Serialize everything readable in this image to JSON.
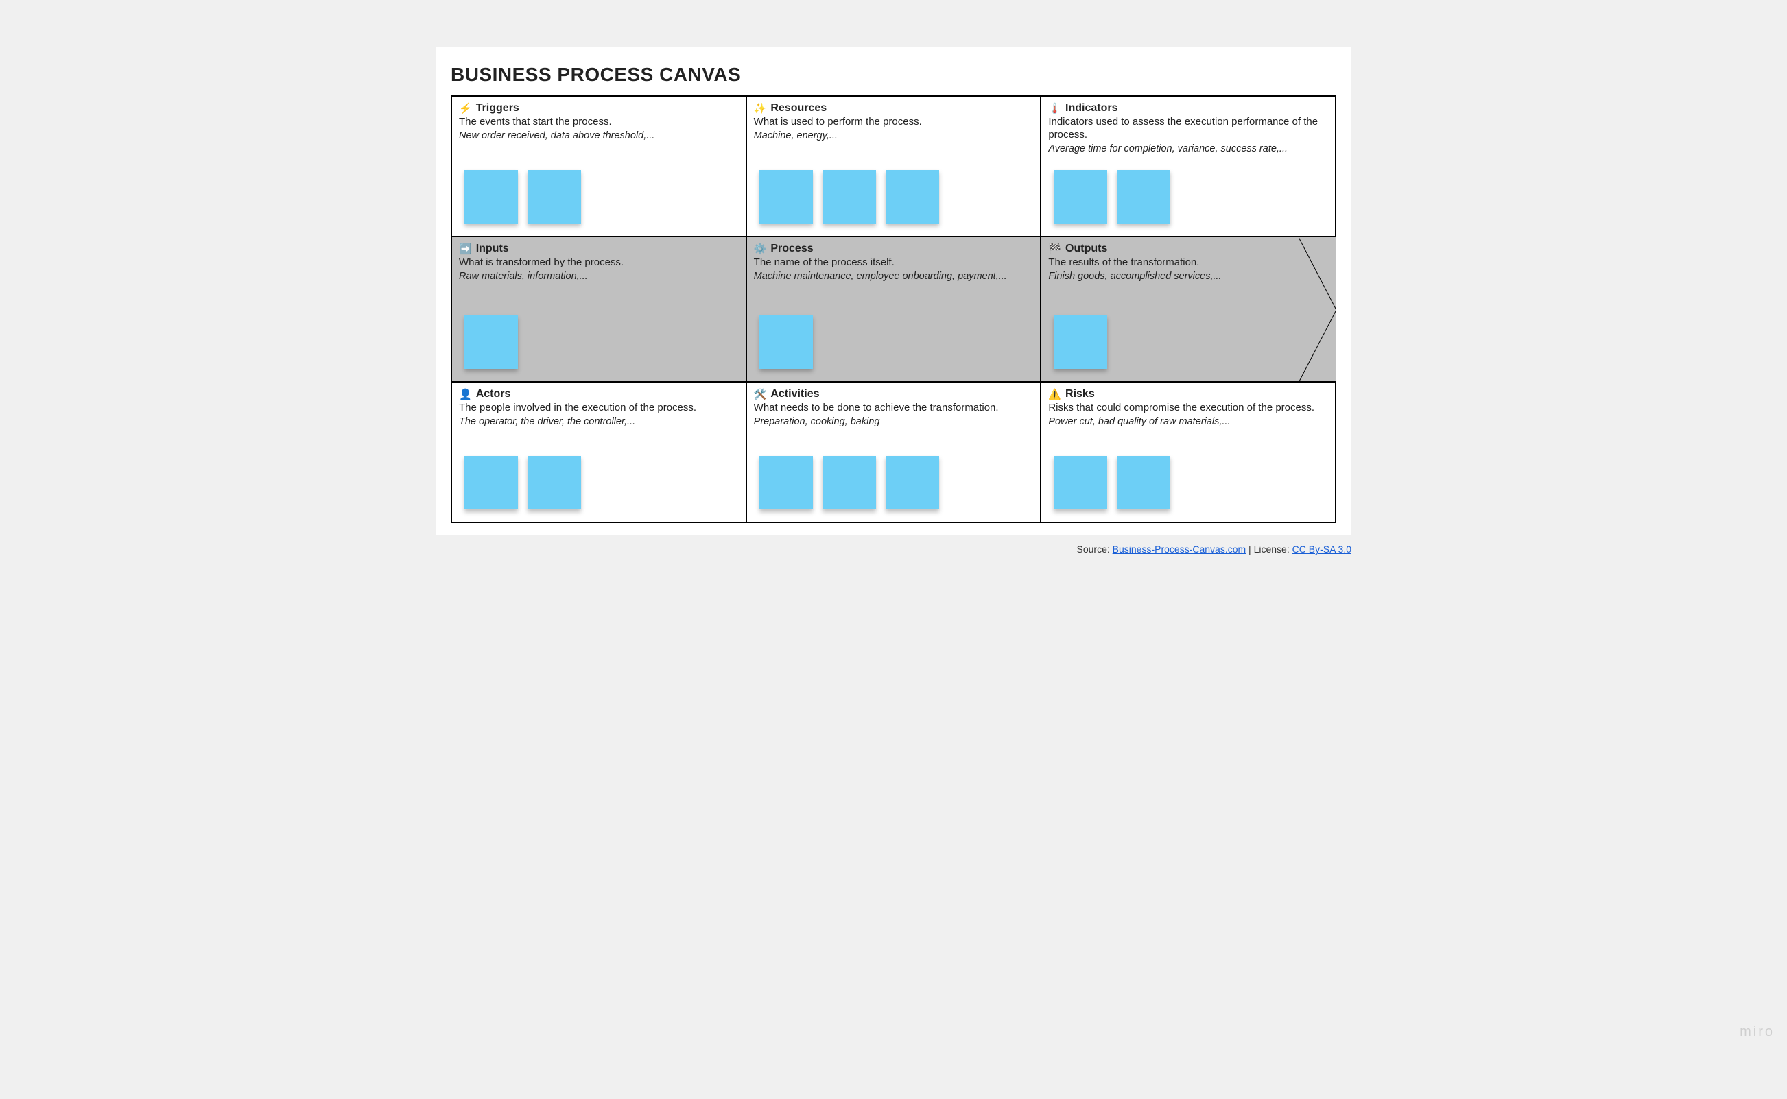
{
  "title": "BUSINESS PROCESS CANVAS",
  "cells": {
    "triggers": {
      "icon": "⚡",
      "name": "Triggers",
      "desc": "The events that start the process.",
      "example": "New order received, data above threshold,...",
      "stickies": 2
    },
    "resources": {
      "icon": "✨",
      "name": "Resources",
      "desc": "What is used to perform the process.",
      "example": "Machine, energy,...",
      "stickies": 3
    },
    "indicators": {
      "icon": "🌡️",
      "name": "Indicators",
      "desc": "Indicators used to assess the execution performance of the process.",
      "example": "Average time for completion, variance, success rate,...",
      "stickies": 2
    },
    "inputs": {
      "icon": "➡️",
      "name": "Inputs",
      "desc": "What is transformed by the process.",
      "example": "Raw materials, information,...",
      "stickies": 1
    },
    "process": {
      "icon": "⚙️",
      "name": "Process",
      "desc": "The name of the process itself.",
      "example": "Machine maintenance, employee onboarding, payment,...",
      "stickies": 1
    },
    "outputs": {
      "icon": "🏁",
      "name": "Outputs",
      "desc": "The results of the transformation.",
      "example": "Finish goods, accomplished services,...",
      "stickies": 1
    },
    "actors": {
      "icon": "👤",
      "name": "Actors",
      "desc": "The people involved in the execution of the process.",
      "example": "The operator, the driver, the controller,...",
      "stickies": 2
    },
    "activities": {
      "icon": "🛠️",
      "name": "Activities",
      "desc": "What needs to be done to achieve the transformation.",
      "example": "Preparation, cooking, baking",
      "stickies": 3
    },
    "risks": {
      "icon": "⚠️",
      "name": "Risks",
      "desc": "Risks that could compromise the execution of the process.",
      "example": "Power cut, bad quality of raw materials,...",
      "stickies": 2
    }
  },
  "footer": {
    "source_label": "Source: ",
    "source_link_text": "Business-Process-Canvas.com",
    "sep": " | License: ",
    "license_link_text": "CC By-SA 3.0"
  },
  "brand": "miro"
}
